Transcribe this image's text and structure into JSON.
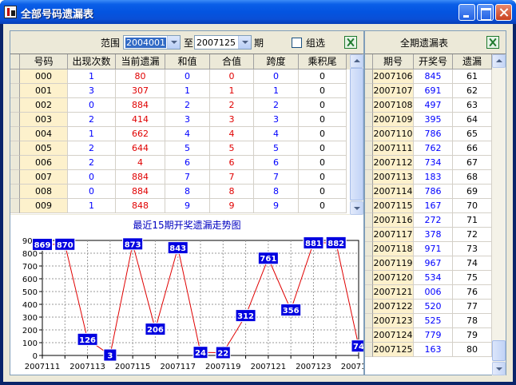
{
  "window": {
    "title": "全部号码遗漏表"
  },
  "filter": {
    "range_label": "范围",
    "from_value": "2004001",
    "to_label": "至",
    "to_value": "2007125",
    "period_label": "期",
    "group_label": "组选",
    "group_checked": false
  },
  "table": {
    "columns": [
      "号码",
      "出现次数",
      "当前遗漏",
      "和值",
      "合值",
      "跨度",
      "乘积尾"
    ],
    "rows": [
      [
        "000",
        "1",
        "80",
        "0",
        "0",
        "0",
        "0"
      ],
      [
        "001",
        "3",
        "307",
        "1",
        "1",
        "1",
        "0"
      ],
      [
        "002",
        "0",
        "884",
        "2",
        "2",
        "2",
        "0"
      ],
      [
        "003",
        "2",
        "414",
        "3",
        "3",
        "3",
        "0"
      ],
      [
        "004",
        "1",
        "662",
        "4",
        "4",
        "4",
        "0"
      ],
      [
        "005",
        "2",
        "644",
        "5",
        "5",
        "5",
        "0"
      ],
      [
        "006",
        "2",
        "4",
        "6",
        "6",
        "6",
        "0"
      ],
      [
        "007",
        "0",
        "884",
        "7",
        "7",
        "7",
        "0"
      ],
      [
        "008",
        "0",
        "884",
        "8",
        "8",
        "8",
        "0"
      ],
      [
        "009",
        "1",
        "848",
        "9",
        "9",
        "9",
        "0"
      ]
    ],
    "column_colors": [
      "#000000",
      "#0000ff",
      "#e00000",
      "#0000ff",
      "#e00000",
      "#0000ff",
      "#000000"
    ]
  },
  "chart_data": {
    "type": "line",
    "title": "最近15期开奖遗漏走势图",
    "x": [
      "2007111",
      "2007112",
      "2007113",
      "2007114",
      "2007115",
      "2007116",
      "2007117",
      "2007118",
      "2007119",
      "2007120",
      "2007121",
      "2007122",
      "2007123",
      "2007124",
      "2007125"
    ],
    "x_tick_labels": [
      "2007111",
      "2007113",
      "2007115",
      "2007117",
      "2007119",
      "2007121",
      "2007123",
      "2007125"
    ],
    "values": [
      869,
      870,
      126,
      3,
      873,
      206,
      843,
      24,
      22,
      312,
      761,
      356,
      881,
      882,
      74
    ],
    "ylim": [
      0,
      900
    ],
    "yticks": [
      0,
      100,
      200,
      300,
      400,
      500,
      600,
      700,
      800,
      900
    ],
    "grid": true,
    "line_color": "#e00000",
    "label_bg": "#0000e0"
  },
  "history": {
    "title": "全期遗漏表",
    "columns": [
      "期号",
      "开奖号",
      "遗漏"
    ],
    "rows": [
      [
        "2007106",
        "845",
        "61"
      ],
      [
        "2007107",
        "691",
        "62"
      ],
      [
        "2007108",
        "497",
        "63"
      ],
      [
        "2007109",
        "395",
        "64"
      ],
      [
        "2007110",
        "786",
        "65"
      ],
      [
        "2007111",
        "762",
        "66"
      ],
      [
        "2007112",
        "734",
        "67"
      ],
      [
        "2007113",
        "183",
        "68"
      ],
      [
        "2007114",
        "786",
        "69"
      ],
      [
        "2007115",
        "167",
        "70"
      ],
      [
        "2007116",
        "272",
        "71"
      ],
      [
        "2007117",
        "378",
        "72"
      ],
      [
        "2007118",
        "971",
        "73"
      ],
      [
        "2007119",
        "967",
        "74"
      ],
      [
        "2007120",
        "534",
        "75"
      ],
      [
        "2007121",
        "006",
        "76"
      ],
      [
        "2007122",
        "520",
        "77"
      ],
      [
        "2007123",
        "525",
        "78"
      ],
      [
        "2007124",
        "779",
        "79"
      ],
      [
        "2007125",
        "163",
        "80"
      ]
    ]
  }
}
